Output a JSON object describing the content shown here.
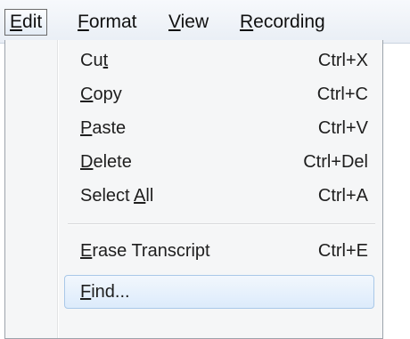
{
  "menubar": {
    "items": [
      {
        "pre": "",
        "key": "E",
        "post": "dit"
      },
      {
        "pre": "",
        "key": "F",
        "post": "ormat"
      },
      {
        "pre": "",
        "key": "V",
        "post": "iew"
      },
      {
        "pre": "",
        "key": "R",
        "post": "ecording"
      }
    ]
  },
  "menu": {
    "items": [
      {
        "pre": "Cu",
        "key": "t",
        "post": "",
        "shortcut": "Ctrl+X"
      },
      {
        "pre": "",
        "key": "C",
        "post": "opy",
        "shortcut": "Ctrl+C"
      },
      {
        "pre": "",
        "key": "P",
        "post": "aste",
        "shortcut": "Ctrl+V"
      },
      {
        "pre": "",
        "key": "D",
        "post": "elete",
        "shortcut": "Ctrl+Del"
      },
      {
        "pre": "Select ",
        "key": "A",
        "post": "ll",
        "shortcut": "Ctrl+A"
      },
      {
        "pre": "",
        "key": "E",
        "post": "rase Transcript",
        "shortcut": "Ctrl+E"
      },
      {
        "pre": "",
        "key": "F",
        "post": "ind...",
        "shortcut": ""
      }
    ]
  }
}
